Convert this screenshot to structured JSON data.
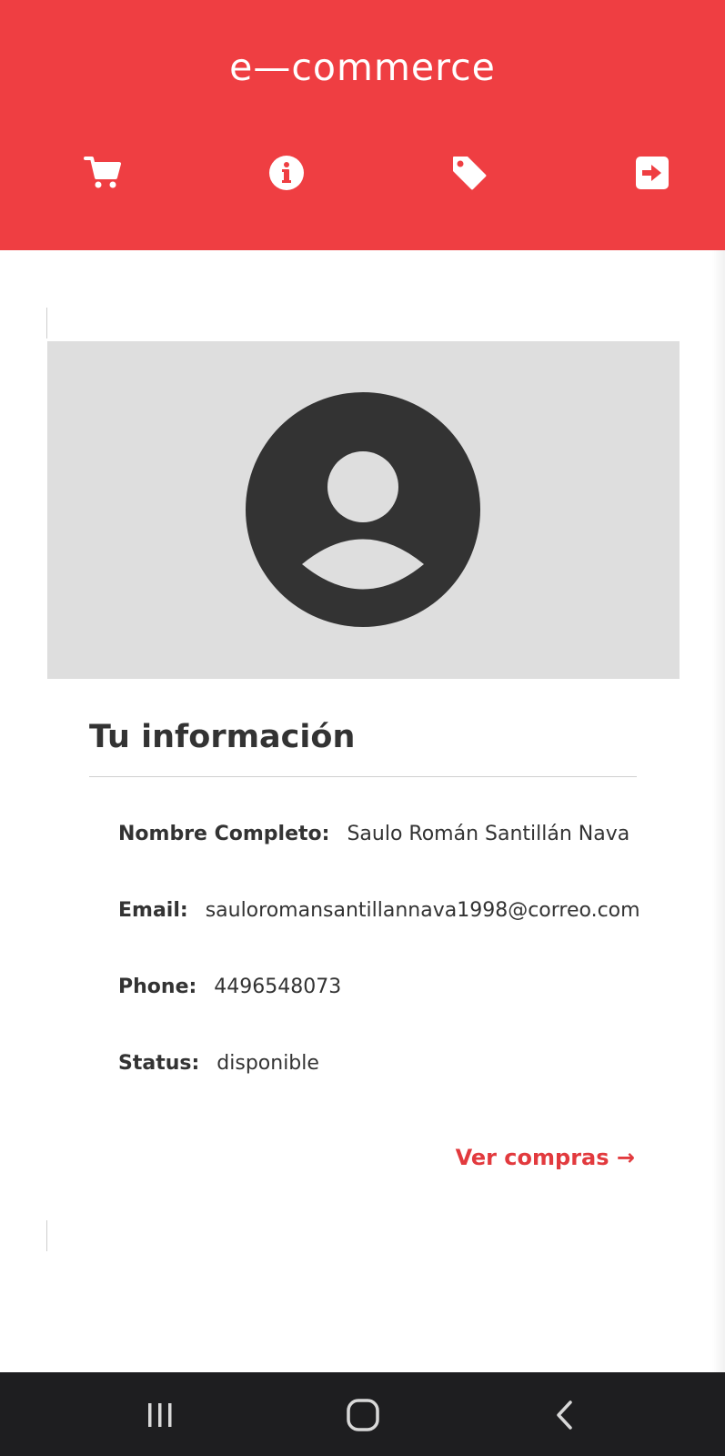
{
  "app": {
    "title": "e—commerce",
    "accent_color": "#ef3e42"
  },
  "header_nav": [
    {
      "icon": "cart-icon"
    },
    {
      "icon": "info-icon"
    },
    {
      "icon": "tag-icon"
    },
    {
      "icon": "logout-icon"
    }
  ],
  "profile": {
    "avatar_icon": "user-avatar-icon",
    "section_title": "Tu información",
    "fields": [
      {
        "label": "Nombre Completo:",
        "value": "Saulo Román Santillán Nava"
      },
      {
        "label": "Email:",
        "value": "sauloromansantillannava1998@correo.com"
      },
      {
        "label": "Phone:",
        "value": "4496548073"
      },
      {
        "label": "Status:",
        "value": "disponible"
      }
    ],
    "link_label": "Ver compras →"
  },
  "system_nav": {
    "buttons": [
      "recents-icon",
      "home-icon",
      "back-icon"
    ]
  }
}
